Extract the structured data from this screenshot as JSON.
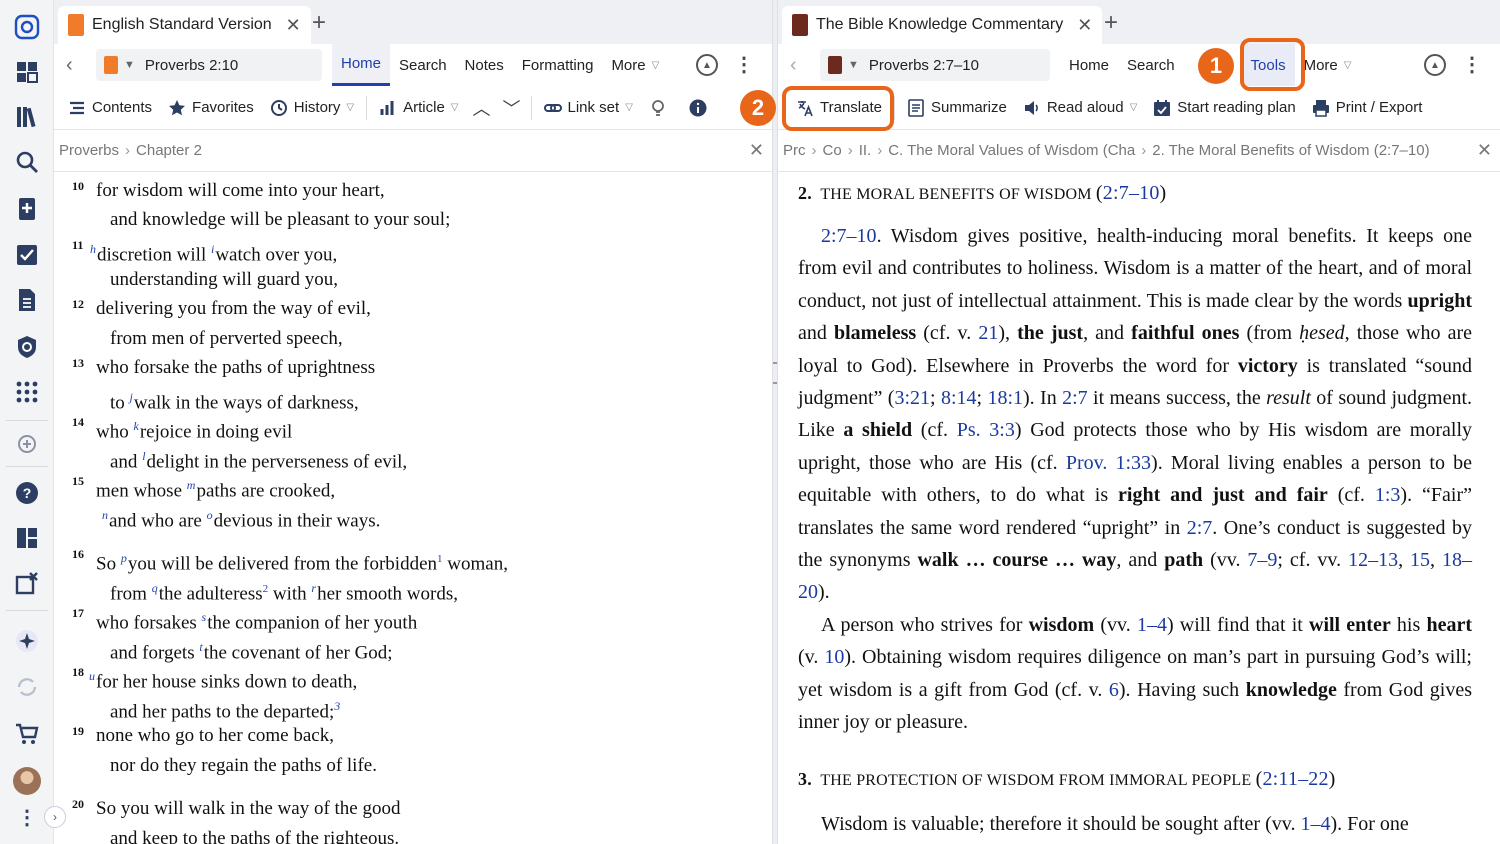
{
  "colors": {
    "accent": "#1f3fae",
    "highlight": "#e8661a",
    "link": "#1a3a9f"
  },
  "rail": {
    "icons": [
      "app-logo-icon",
      "dashboard-icon",
      "library-icon",
      "search-icon",
      "bible-add-icon",
      "checklist-icon",
      "document-icon",
      "shield-icon",
      "apps-grid-icon",
      "add-circle-icon",
      "help-icon",
      "layouts-icon",
      "close-panels-icon",
      "sparkle-ai-icon",
      "sync-icon",
      "cart-icon",
      "avatar",
      "more-vertical-icon"
    ]
  },
  "left": {
    "tab_title": "English Standard Version",
    "reference": "Proverbs 2:10",
    "nav_tabs": [
      "Home",
      "Search",
      "Notes",
      "Formatting",
      "More"
    ],
    "toolbar": {
      "contents": "Contents",
      "favorites": "Favorites",
      "history": "History",
      "article": "Article",
      "link_set": "Link set"
    },
    "breadcrumb": [
      "Proverbs",
      "Chapter 2"
    ],
    "verses": [
      {
        "n": "10",
        "a": "for wisdom will come into your heart,",
        "b": "and knowledge will be pleasant to your soul;"
      },
      {
        "n": "11",
        "h": "h",
        "a1": "discretion will ",
        "i": "i",
        "a2": "watch over you,",
        "b": "understanding will guard you,"
      },
      {
        "n": "12",
        "a": "delivering you from the way of evil,",
        "b": "from men of perverted speech,"
      },
      {
        "n": "13",
        "a": "who forsake the paths of uprightness",
        "b1": "to ",
        "j": "j",
        "b2": "walk in the ways of darkness,"
      },
      {
        "n": "14",
        "a1": "who ",
        "k": "k",
        "a2": "rejoice in doing evil",
        "b1": "and ",
        "l": "l",
        "b2": "delight in the perverseness of evil,"
      },
      {
        "n": "15",
        "a1": "men whose ",
        "m": "m",
        "a2": "paths are crooked,",
        "nfl": "n",
        "b1": "and who are ",
        "o": "o",
        "b2": "devious in their ways."
      },
      {
        "n": "16",
        "a1": "So ",
        "p": "p",
        "a2": "you will be delivered from the forbidden",
        "f1": "1",
        "a3": " woman,",
        "b1": "from ",
        "q": "q",
        "b2": "the adulteress",
        "f2": "2",
        "b3": " with ",
        "r": "r",
        "b4": "her smooth words,"
      },
      {
        "n": "17",
        "a1": "who forsakes ",
        "s": "s",
        "a2": "the companion of her youth",
        "b1": "and forgets ",
        "t": "t",
        "b2": "the covenant of her God;"
      },
      {
        "n": "18",
        "u": "u",
        "a": "for her house sinks down to death,",
        "b": "and her paths to the departed;",
        "f3": "3"
      },
      {
        "n": "19",
        "a": "none who go to her come back,",
        "b": "nor do they regain the paths of life."
      },
      {
        "n": "20",
        "a": "So you will walk in the way of the good",
        "b": "and keep to the paths of the righteous."
      }
    ]
  },
  "right": {
    "tab_title": "The Bible Knowledge Commentary",
    "reference": "Proverbs 2:7–10",
    "nav_tabs": [
      "Home",
      "Search",
      "Tools",
      "More"
    ],
    "toolbar": {
      "translate": "Translate",
      "summarize": "Summarize",
      "read_aloud": "Read aloud",
      "reading_plan": "Start reading plan",
      "print": "Print / Export"
    },
    "breadcrumb": [
      "Prc",
      "Co",
      "II. ",
      "C. The Moral Values of Wisdom (Cha",
      "2. The Moral Benefits of Wisdom (2:7–10)"
    ],
    "badges": [
      "1",
      "2"
    ],
    "sections": {
      "h2_num": "2.",
      "h2_text": "THE MORAL BENEFITS OF WISDOM",
      "h2_ref": "2:7–10",
      "h3_num": "3.",
      "h3_text": "THE PROTECTION OF WISDOM FROM IMMORAL PEOPLE",
      "h3_ref": "2:11–22"
    },
    "p1": {
      "ref": "2:7–10",
      "t1": ". Wisdom gives positive, health-inducing moral benefits. It keeps one from evil and contributes to holiness. Wisdom is a matter of the heart, and of moral conduct, not just of intellectual attainment. This is made clear by the words ",
      "upright": "upright",
      "t2": " and ",
      "blameless": "blameless",
      "t3": " (cf. v. ",
      "v21": "21",
      "t4": "), ",
      "just": "the just",
      "t5": ", and ",
      "faithful": "faithful ones",
      "t6": " (from ",
      "hesed": "ḥesed",
      "t7": ", those who are loyal to God). Elsewhere in Proverbs the word for ",
      "victory": "victory",
      "t8": " is translated “sound judgment” (",
      "r1": "3:21",
      "s1": "; ",
      "r2": "8:14",
      "s2": "; ",
      "r3": "18:1",
      "t9": "). In ",
      "r4": "2:7",
      "t10": " it means success, the ",
      "result": "result",
      "t11": " of sound judgment. Like ",
      "shield": "a shield",
      "t12": " (cf. ",
      "r5": "Ps. 3:3",
      "t13": ") God protects those who by His wisdom are morally upright, those who are His (cf. ",
      "r6": "Prov. 1:33",
      "t14": "). Moral living enables a person to be equitable with others, to do what is ",
      "rjf": "right and just and fair",
      "t15": " (cf. ",
      "r7": "1:3",
      "t16": "). “Fair” translates the same word rendered “upright” in ",
      "r8": "2:7",
      "t17": ". One’s conduct is suggested by the synonyms ",
      "walk": "walk … course … way",
      "t18": ", and ",
      "path": "path",
      "t19": " (vv. ",
      "r9": "7–9",
      "t20": "; cf. vv. ",
      "r10": "12–13",
      "c1": ", ",
      "r11": "15",
      "c2": ", ",
      "r12": "18–20",
      "t21": ")."
    },
    "p2": {
      "t1": "A person who strives for ",
      "wisdom": "wisdom",
      "t2": " (vv. ",
      "r1": "1–4",
      "t3": ") will find that it ",
      "enter": "will enter",
      "t4": " his ",
      "heart": "heart",
      "t5": " (v. ",
      "r2": "10",
      "t6": "). Obtaining wisdom requires diligence on man’s part in pursuing God’s will; yet wisdom is a gift from God (cf. v. ",
      "r3": "6",
      "t7": "). Having such ",
      "knowledge": "knowledge",
      "t8": " from God gives inner joy or pleasure."
    },
    "p3": {
      "t1": "Wisdom is valuable; therefore it should be sought after (vv. ",
      "r1": "1–4",
      "t2": "). For one"
    }
  }
}
